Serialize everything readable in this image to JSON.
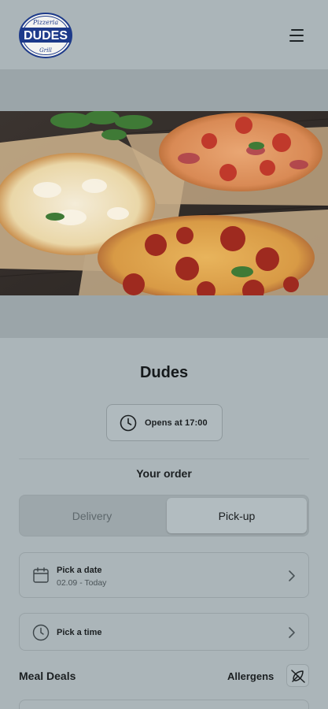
{
  "brand": {
    "logo_top_text": "Pizzeria",
    "logo_main_text": "DUDES",
    "logo_bottom_text": "Grill"
  },
  "header": {
    "menu_icon": "hamburger-menu-icon"
  },
  "hero": {
    "image": "pizza-photo"
  },
  "store": {
    "name": "Dudes",
    "opens_text": "Opens at 17:00"
  },
  "order": {
    "section_title": "Your order",
    "modes": [
      "Delivery",
      "Pick-up"
    ],
    "selected_mode": "Pick-up",
    "date_title": "Pick a date",
    "date_value": "02.09 - Today",
    "time_title": "Pick a time"
  },
  "menu": {
    "section_title": "Meal Deals",
    "allergens_label": "Allergens"
  },
  "colors": {
    "background": "#abb5b9",
    "hero_band": "#9ba5a9",
    "text": "#1b1f21",
    "logo_blue": "#1d3a8a"
  }
}
